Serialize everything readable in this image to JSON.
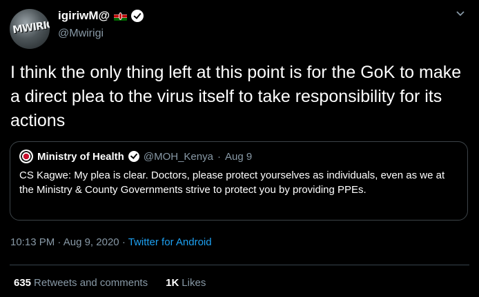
{
  "user": {
    "display_name": "igiriwM@",
    "handle": "@Mwirigi",
    "avatar_text": "MWIRIGI"
  },
  "tweet": {
    "text": "I think the only thing left at this point is for the GoK to make a direct plea to the virus itself to take responsibility for its actions"
  },
  "quoted": {
    "name": "Ministry of Health",
    "handle": "@MOH_Kenya",
    "separator": "·",
    "date": "Aug 9",
    "text": "CS Kagwe: My plea is clear. Doctors, please protect yourselves as individuals, even as we at the Ministry & County Governments strive to protect you by providing PPEs."
  },
  "meta": {
    "time": "10:13 PM",
    "sep1": "·",
    "date": "Aug 9, 2020",
    "sep2": "·",
    "source": "Twitter for Android"
  },
  "stats": {
    "retweets_count": "635",
    "retweets_label": "Retweets and comments",
    "likes_count": "1K",
    "likes_label": "Likes"
  },
  "icons": {
    "verified": "verified-badge-icon",
    "flag": "kenya-flag-icon",
    "chevron": "chevron-down-icon",
    "crest": "ministry-crest-icon"
  },
  "colors": {
    "background": "#000000",
    "text": "#ffffff",
    "muted": "#8899a6",
    "link": "#1da1f2",
    "border": "#3d4449"
  }
}
